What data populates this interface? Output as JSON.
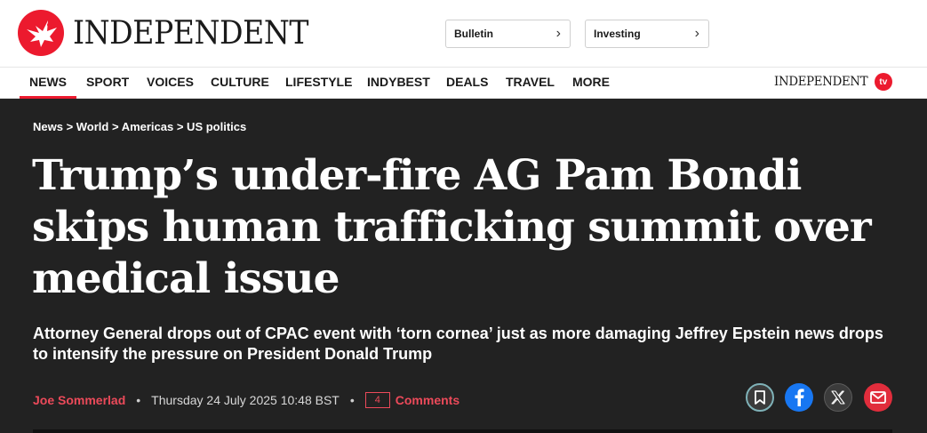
{
  "header": {
    "logo_text": "INDEPENDENT",
    "pills": [
      {
        "label": "Bulletin"
      },
      {
        "label": "Investing"
      }
    ],
    "chevron": "›"
  },
  "nav": {
    "items": [
      {
        "label": "NEWS",
        "active": true
      },
      {
        "label": "SPORT"
      },
      {
        "label": "VOICES"
      },
      {
        "label": "CULTURE"
      },
      {
        "label": "LIFESTYLE"
      },
      {
        "label": "INDYBEST"
      },
      {
        "label": "DEALS"
      },
      {
        "label": "TRAVEL"
      },
      {
        "label": "MORE"
      }
    ],
    "tv_text": "INDEPENDENT",
    "tv_badge": "tv"
  },
  "article": {
    "breadcrumb": "News > World > Americas > US politics",
    "headline": "Trump’s under-fire AG Pam Bondi skips human trafficking summit over medical issue",
    "standfirst": "Attorney General drops out of CPAC event with ‘torn cornea’ just as more damaging Jeffrey Epstein news drops to intensify the pressure on President Donald Trump",
    "author": "Joe Sommerlad",
    "separator": "•",
    "timestamp": "Thursday 24 July 2025 10:48 BST",
    "comment_count": "4",
    "comments_label": "Comments"
  },
  "share_icons": [
    "bookmark-icon",
    "facebook-icon",
    "x-icon",
    "email-icon"
  ],
  "colors": {
    "brand_red": "#ec1a2e",
    "hero_bg": "#222222",
    "author_red": "#ec4a5a",
    "facebook_blue": "#1877f2"
  }
}
